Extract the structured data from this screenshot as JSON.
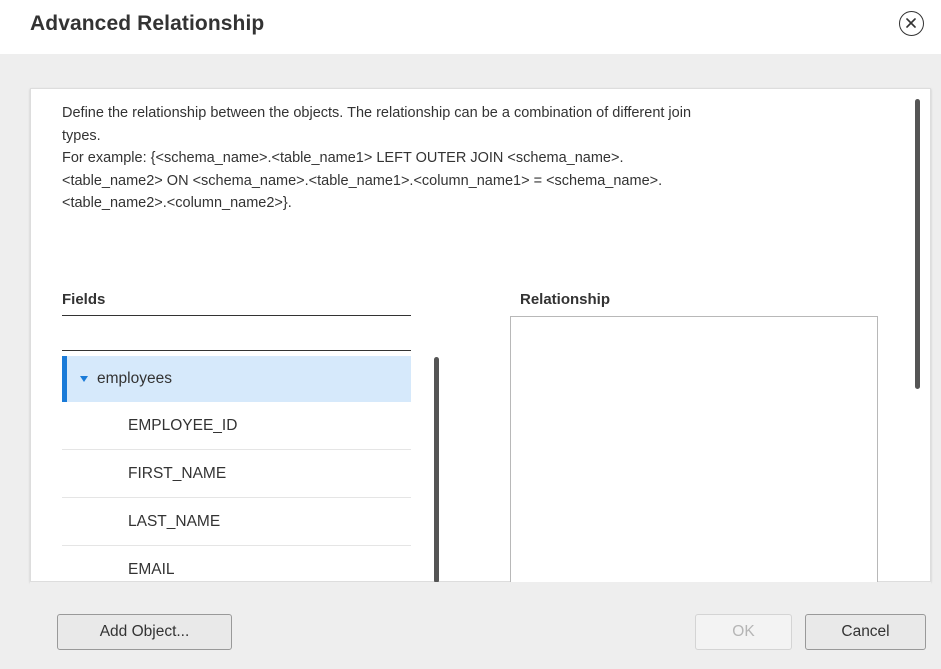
{
  "dialog": {
    "title": "Advanced Relationship",
    "close_icon": "close-circle-icon"
  },
  "description": {
    "lines": [
      "Define the relationship between the objects. The relationship can be a combination of different join",
      "types.",
      "For example: {<schema_name>.<table_name1> LEFT OUTER JOIN <schema_name>.",
      "<table_name2> ON <schema_name>.<table_name1>.<column_name1> = <schema_name>.",
      "<table_name2>.<column_name2>}."
    ]
  },
  "fields": {
    "label": "Fields",
    "search_value": "",
    "tree": {
      "parent": {
        "label": "employees",
        "expanded": true,
        "icon": "caret-down-icon"
      },
      "children": [
        "EMPLOYEE_ID",
        "FIRST_NAME",
        "LAST_NAME",
        "EMAIL"
      ]
    }
  },
  "relationship": {
    "label": "Relationship",
    "value": ""
  },
  "buttons": {
    "add_object": "Add Object...",
    "ok": "OK",
    "cancel": "Cancel",
    "ok_disabled": true
  },
  "colors": {
    "accent": "#1a7bd8",
    "selected_row": "#d6e9fb",
    "dialog_body": "#eeeeee"
  }
}
